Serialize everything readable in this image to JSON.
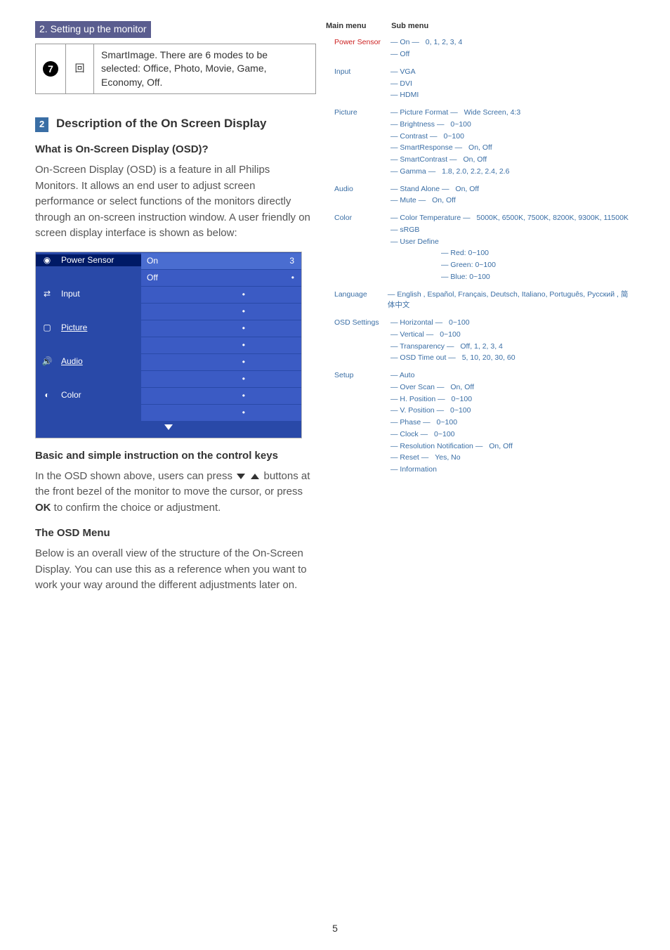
{
  "header": "2. Setting up the monitor",
  "topTable": {
    "num": "7",
    "iconName": "smartimage-icon",
    "text": "SmartImage. There are 6 modes to be selected: Office, Photo, Movie, Game, Economy, Off."
  },
  "sec2": {
    "num": "2",
    "title": "Description of the On Screen Display",
    "q": "What is On-Screen Display (OSD)?",
    "p1": "On-Screen Display (OSD) is a feature in all Philips Monitors. It allows an end user to adjust screen performance or select functions of the monitors directly through an on-screen instruction window. A user friendly on screen display interface is shown as below:"
  },
  "osd": {
    "rows": [
      {
        "icon": "sensor-icon",
        "label": "Power Sensor"
      },
      {
        "icon": "input-icon",
        "label": "Input"
      },
      {
        "icon": "picture-icon",
        "label": "Picture"
      },
      {
        "icon": "audio-icon",
        "label": "Audio"
      },
      {
        "icon": "color-icon",
        "label": "Color"
      }
    ],
    "on": "On",
    "off": "Off",
    "val": "3"
  },
  "sec3": {
    "title": "Basic and simple instruction on the control keys",
    "p1a": "In the OSD shown above, users can press ",
    "p1b": " buttons at the front bezel of the monitor to move the cursor, or press ",
    "ok": "OK",
    "p1c": " to confirm the choice or adjustment."
  },
  "sec4": {
    "title": "The OSD Menu",
    "p1": "Below is an overall view of the structure of the On-Screen Display. You can use this as a reference when you want to work your way around the different adjustments later on."
  },
  "chart_data": {
    "type": "table",
    "headers": {
      "main": "Main menu",
      "sub": "Sub menu"
    },
    "tree": [
      {
        "name": "Power Sensor",
        "red": true,
        "children": [
          {
            "name": "On",
            "values": "0, 1, 2, 3, 4"
          },
          {
            "name": "Off"
          }
        ]
      },
      {
        "name": "Input",
        "children": [
          {
            "name": "VGA"
          },
          {
            "name": "DVI"
          },
          {
            "name": "HDMI"
          }
        ]
      },
      {
        "name": "Picture",
        "children": [
          {
            "name": "Picture Format",
            "values": "Wide Screen, 4:3"
          },
          {
            "name": "Brightness",
            "values": "0~100"
          },
          {
            "name": "Contrast",
            "values": "0~100"
          },
          {
            "name": "SmartResponse",
            "values": "On, Off"
          },
          {
            "name": "SmartContrast",
            "values": "On, Off"
          },
          {
            "name": "Gamma",
            "values": "1.8, 2.0, 2.2, 2.4, 2.6"
          }
        ]
      },
      {
        "name": "Audio",
        "children": [
          {
            "name": "Stand Alone",
            "values": "On, Off"
          },
          {
            "name": "Mute",
            "values": "On, Off"
          }
        ]
      },
      {
        "name": "Color",
        "children": [
          {
            "name": "Color Temperature",
            "values": "5000K, 6500K, 7500K, 8200K, 9300K, 11500K"
          },
          {
            "name": "sRGB"
          },
          {
            "name": "User Define",
            "children": [
              {
                "name": "Red: 0~100"
              },
              {
                "name": "Green: 0~100"
              },
              {
                "name": "Blue: 0~100"
              }
            ]
          }
        ]
      },
      {
        "name": "Language",
        "children": [
          {
            "name": "English , Español, Français, Deutsch, Italiano, Português, Русский , 简体中文"
          }
        ]
      },
      {
        "name": "OSD Settings",
        "children": [
          {
            "name": "Horizontal",
            "values": "0~100"
          },
          {
            "name": "Vertical",
            "values": "0~100"
          },
          {
            "name": "Transparency",
            "values": "Off, 1, 2, 3, 4"
          },
          {
            "name": "OSD Time out",
            "values": "5, 10, 20, 30, 60"
          }
        ]
      },
      {
        "name": "Setup",
        "children": [
          {
            "name": "Auto"
          },
          {
            "name": "Over Scan",
            "values": "On, Off"
          },
          {
            "name": "H. Position",
            "values": "0~100"
          },
          {
            "name": "V. Position",
            "values": "0~100"
          },
          {
            "name": "Phase",
            "values": "0~100"
          },
          {
            "name": "Clock",
            "values": "0~100"
          },
          {
            "name": "Resolution Notification",
            "values": "On, Off"
          },
          {
            "name": "Reset",
            "values": "Yes, No"
          },
          {
            "name": "Information"
          }
        ]
      }
    ]
  },
  "pageNum": "5"
}
